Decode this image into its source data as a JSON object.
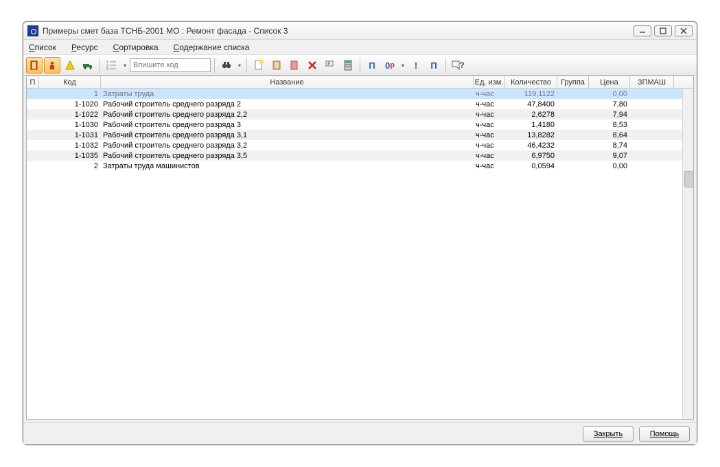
{
  "window": {
    "title": "Примеры смет база ТСНБ-2001 МО : Ремонт фасада - Список 3"
  },
  "menu": {
    "spisok_pre": "С",
    "spisok_rest": "писок",
    "resurs_pre": "Р",
    "resurs_rest": "есурс",
    "sort_pre": "С",
    "sort_rest": "ортировка",
    "content_pre": "С",
    "content_rest": "одержание списка"
  },
  "toolbar": {
    "code_placeholder": "Впишите код",
    "t_pi": "П",
    "t_zero": "0",
    "t_rub": "р",
    "t_bang": "!",
    "t_pi2": "П",
    "t_help": "?"
  },
  "columns": {
    "c0": "П",
    "c1": "Код",
    "c2": "Название",
    "c3": "Ед. изм.",
    "c4": "Количество",
    "c5": "Группа",
    "c6": "Цена",
    "c7": "ЗПМАШ"
  },
  "rows": [
    {
      "selected": true,
      "code": "1",
      "name": "Затраты труда",
      "unit": "ч-час",
      "qty": "119,1122",
      "group": "",
      "price": "0,00",
      "zp": ""
    },
    {
      "selected": false,
      "code": "1-1020",
      "name": "Рабочий строитель среднего разряда 2",
      "unit": "ч-час",
      "qty": "47,8400",
      "group": "",
      "price": "7,80",
      "zp": ""
    },
    {
      "selected": false,
      "code": "1-1022",
      "name": "Рабочий строитель среднего разряда 2,2",
      "unit": "ч-час",
      "qty": "2,6278",
      "group": "",
      "price": "7,94",
      "zp": ""
    },
    {
      "selected": false,
      "code": "1-1030",
      "name": "Рабочий строитель среднего разряда 3",
      "unit": "ч-час",
      "qty": "1,4180",
      "group": "",
      "price": "8,53",
      "zp": ""
    },
    {
      "selected": false,
      "code": "1-1031",
      "name": "Рабочий строитель среднего разряда 3,1",
      "unit": "ч-час",
      "qty": "13,8282",
      "group": "",
      "price": "8,64",
      "zp": ""
    },
    {
      "selected": false,
      "code": "1-1032",
      "name": "Рабочий строитель среднего разряда 3,2",
      "unit": "ч-час",
      "qty": "46,4232",
      "group": "",
      "price": "8,74",
      "zp": ""
    },
    {
      "selected": false,
      "code": "1-1035",
      "name": "Рабочий строитель среднего разряда 3,5",
      "unit": "ч-час",
      "qty": "6,9750",
      "group": "",
      "price": "9,07",
      "zp": ""
    },
    {
      "selected": false,
      "code": "2",
      "name": "Затраты труда машинистов",
      "unit": "ч-час",
      "qty": "0,0594",
      "group": "",
      "price": "0,00",
      "zp": ""
    }
  ],
  "footer": {
    "close": "Закрыть",
    "help": "Помощь"
  }
}
